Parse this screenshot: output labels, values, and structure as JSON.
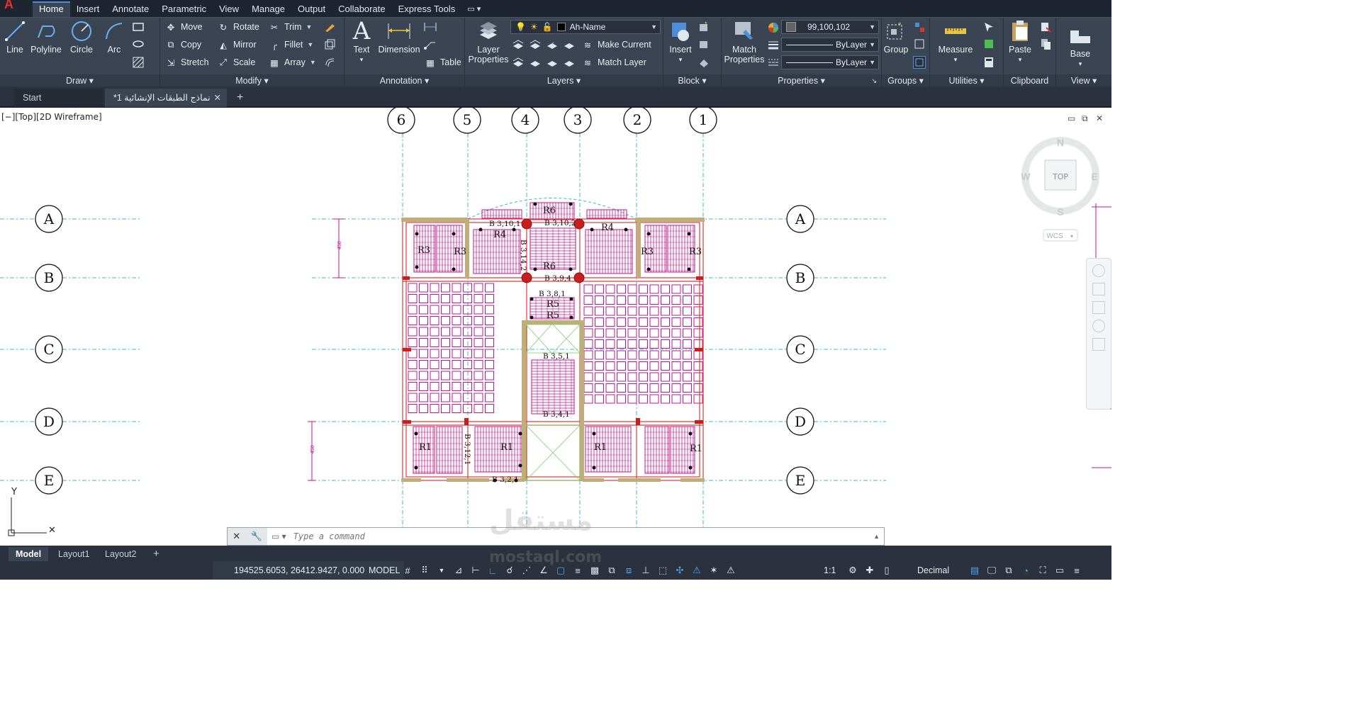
{
  "ribbon_tabs": [
    "Home",
    "Insert",
    "Annotate",
    "Parametric",
    "View",
    "Manage",
    "Output",
    "Collaborate",
    "Express Tools"
  ],
  "active_tab": "Home",
  "draw_panel": {
    "title": "Draw",
    "line": "Line",
    "polyline": "Polyline",
    "circle": "Circle",
    "arc": "Arc"
  },
  "modify_panel": {
    "title": "Modify",
    "move": "Move",
    "rotate": "Rotate",
    "trim": "Trim",
    "copy": "Copy",
    "mirror": "Mirror",
    "fillet": "Fillet",
    "stretch": "Stretch",
    "scale": "Scale",
    "array": "Array"
  },
  "annotation_panel": {
    "title": "Annotation",
    "text": "Text",
    "dimension": "Dimension",
    "table": "Table"
  },
  "layers_panel": {
    "title": "Layers",
    "layer_properties": "Layer Properties",
    "current_layer": "Ah-Name",
    "make_current": "Make Current",
    "match_layer": "Match Layer"
  },
  "block_panel": {
    "title": "Block",
    "insert": "Insert"
  },
  "properties_panel": {
    "title": "Properties",
    "match_properties": "Match Properties",
    "color": "99,100,102",
    "linetype": "ByLayer",
    "lineweight": "ByLayer"
  },
  "groups_panel": {
    "title": "Groups",
    "group": "Group"
  },
  "utilities_panel": {
    "title": "Utilities",
    "measure": "Measure"
  },
  "clipboard_panel": {
    "title": "Clipboard",
    "paste": "Paste"
  },
  "view_panel": {
    "title": "View",
    "base": "Base"
  },
  "file_tabs": {
    "start": "Start",
    "document": "نماذج الطبقات الإنشائية 1*"
  },
  "viewport_label": "[−][Top][2D Wireframe]",
  "viewcube": {
    "top": "TOP",
    "n": "N",
    "s": "S",
    "e": "E",
    "w": "W",
    "wcs": "WCS"
  },
  "drawing": {
    "column_grid": [
      "6",
      "5",
      "4",
      "3",
      "2",
      "1"
    ],
    "row_grid": [
      "A",
      "B",
      "C",
      "D",
      "E"
    ],
    "beam_labels": [
      "B 3,10,1",
      "B 3,10,2",
      "B 3,14,2",
      "B 3,9,4",
      "B 3,8,1",
      "B 3,5,1",
      "B 3,4,1",
      "B 3,12,1",
      "B 3,2,1"
    ],
    "slab_labels": [
      "R6",
      "R4",
      "R4",
      "R3",
      "R3",
      "R3",
      "R3",
      "R6",
      "R5",
      "R5",
      "R1",
      "R1",
      "R1",
      "R1"
    ],
    "dim_text": "450"
  },
  "command": {
    "placeholder": "Type a command"
  },
  "layout_tabs": [
    "Model",
    "Layout1",
    "Layout2"
  ],
  "status": {
    "coords": "194525.6053, 26412.9427, 0.0000",
    "mode": "MODEL",
    "scale": "1:1",
    "units": "Decimal"
  },
  "watermark": {
    "arabic": "مستقل",
    "latin": "mostaql.com"
  },
  "colors": {
    "accent": "#4c8fd6",
    "ribbon": "#3b4453",
    "magenta": "#c0148c",
    "red_line": "#e03a3a",
    "grid_cyan": "#3bb8c8",
    "column_red": "#c81e1e",
    "wall": "#bfae7a"
  }
}
